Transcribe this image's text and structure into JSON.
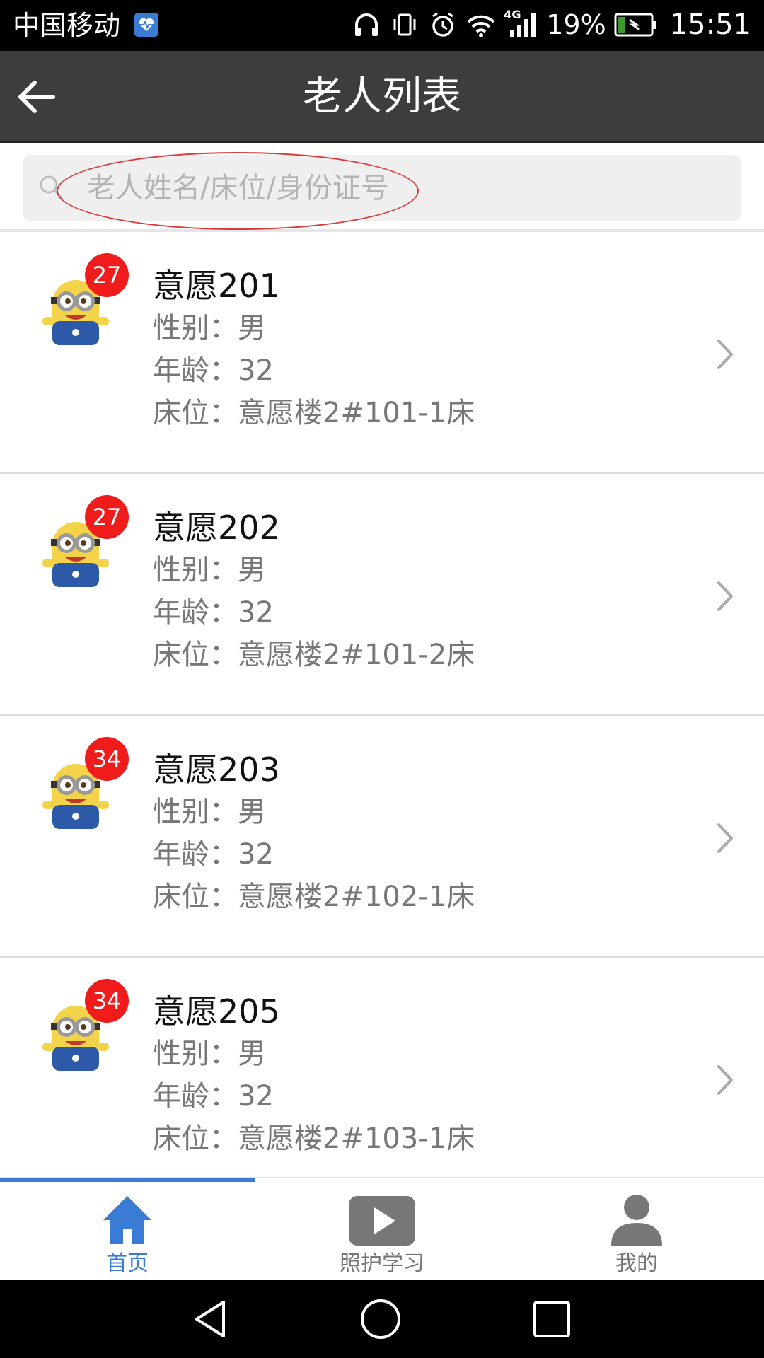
{
  "status_bar": {
    "carrier": "中国移动",
    "network": "4G",
    "battery": "19%",
    "time": "15:51"
  },
  "header": {
    "title": "老人列表"
  },
  "search": {
    "placeholder": "老人姓名/床位/身份证号"
  },
  "elders": [
    {
      "badge": "27",
      "name": "意愿201",
      "gender": "性别：男",
      "age": "年龄：32",
      "bed": "床位：意愿楼2#101-1床"
    },
    {
      "badge": "27",
      "name": "意愿202",
      "gender": "性别：男",
      "age": "年龄：32",
      "bed": "床位：意愿楼2#101-2床"
    },
    {
      "badge": "34",
      "name": "意愿203",
      "gender": "性别：男",
      "age": "年龄：32",
      "bed": "床位：意愿楼2#102-1床"
    },
    {
      "badge": "34",
      "name": "意愿205",
      "gender": "性别：男",
      "age": "年龄：32",
      "bed": "床位：意愿楼2#103-1床"
    }
  ],
  "bottom_nav": [
    {
      "label": "首页",
      "icon": "home-icon",
      "active": true
    },
    {
      "label": "照护学习",
      "icon": "video-play-icon",
      "active": false
    },
    {
      "label": "我的",
      "icon": "user-icon",
      "active": false
    }
  ],
  "colors": {
    "accent": "#3a7bd5",
    "badge": "#f01c1c",
    "app_bar": "#3d3d3d",
    "annotation_ellipse": "#d63a3a"
  }
}
